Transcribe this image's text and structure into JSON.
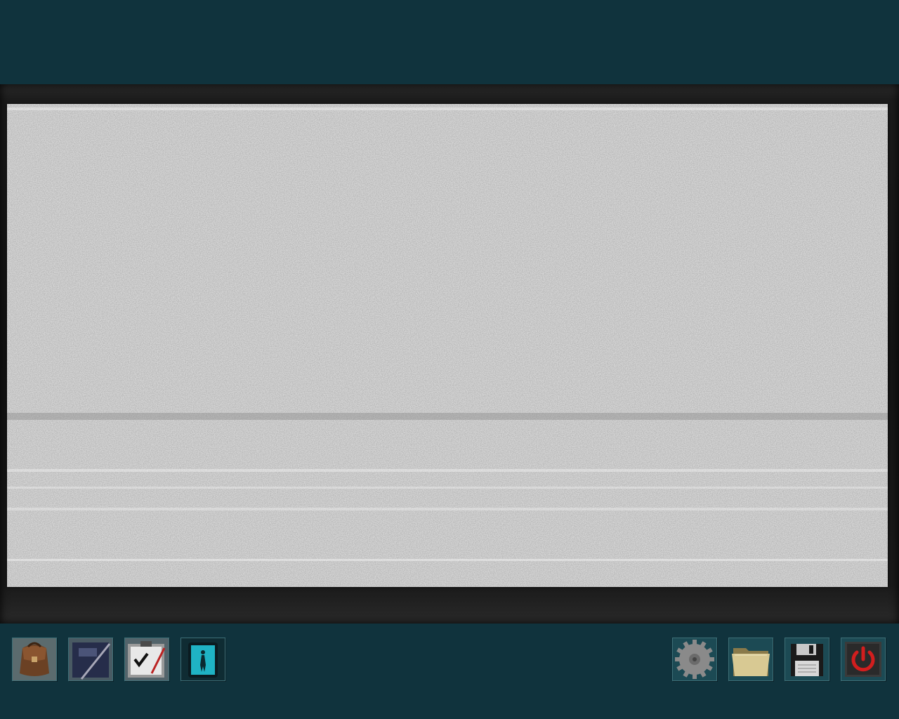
{
  "scene": {
    "screen_content": "static",
    "screen_state": "no-signal"
  },
  "toolbar_left": [
    {
      "id": "bag",
      "icon": "satchel-icon"
    },
    {
      "id": "notebook",
      "icon": "notebook-icon"
    },
    {
      "id": "tasks",
      "icon": "checklist-clipboard-icon"
    },
    {
      "id": "phone",
      "icon": "cell-phone-icon"
    }
  ],
  "toolbar_right": [
    {
      "id": "settings",
      "icon": "gear-icon"
    },
    {
      "id": "files",
      "icon": "folder-icon"
    },
    {
      "id": "save",
      "icon": "floppy-disk-icon"
    },
    {
      "id": "quit",
      "icon": "power-icon"
    }
  ],
  "colors": {
    "background": "#10333d",
    "button_face": "#1c4a54",
    "button_border": "#3e6f77",
    "power_accent": "#d21e1e",
    "phone_screen": "#1fb3c4"
  }
}
